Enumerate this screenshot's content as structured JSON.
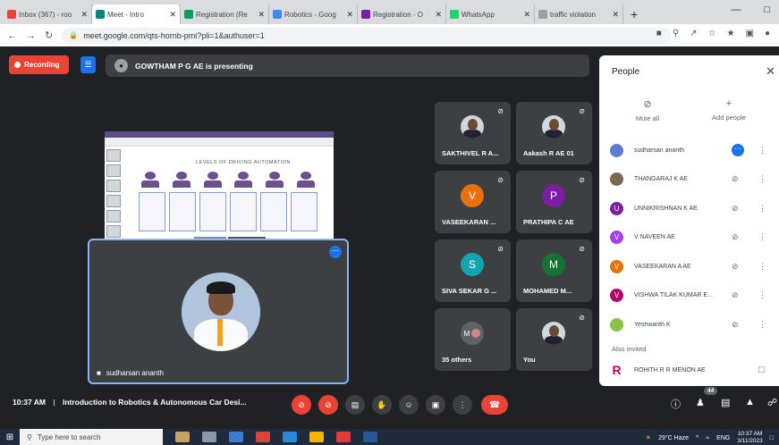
{
  "browser": {
    "tabs": [
      {
        "label": "Inbox (367) - roo",
        "color": "#ea4335",
        "active": false
      },
      {
        "label": "Meet - Intro",
        "color": "#00897b",
        "active": true
      },
      {
        "label": "Registration (Re",
        "color": "#0f9d58",
        "active": false
      },
      {
        "label": "Robotics - Goog",
        "color": "#4285f4",
        "active": false
      },
      {
        "label": "Registration - O",
        "color": "#7b1fa2",
        "active": false
      },
      {
        "label": "WhatsApp",
        "color": "#25d366",
        "active": false
      },
      {
        "label": "traffic violation",
        "color": "#9e9e9e",
        "active": false
      }
    ],
    "new_tab": "+",
    "url": "meet.google.com/qts-hornb-pmi?pli=1&authuser=1"
  },
  "meet": {
    "recording_label": "Recording",
    "presenter_text": "GOWTHAM P G AE is presenting",
    "slide": {
      "title": "LEVELS OF DRIVING AUTOMATION"
    },
    "self_tile_name": "sudharsan ananth",
    "tiles": [
      {
        "name": "SAKTHIVEL R A...",
        "avatar_type": "photo"
      },
      {
        "name": "Aakash R AE 01",
        "avatar_type": "photo"
      },
      {
        "name": "VASEEKARAN ...",
        "avatar_type": "letter",
        "letter": "V",
        "color": "#e8710a"
      },
      {
        "name": "PRATHIPA C AE",
        "avatar_type": "letter",
        "letter": "P",
        "color": "#7b1fa2"
      },
      {
        "name": "SIVA SEKAR G ...",
        "avatar_type": "letter",
        "letter": "S",
        "color": "#12a4af"
      },
      {
        "name": "MOHAMED M...",
        "avatar_type": "letter",
        "letter": "M",
        "color": "#137333"
      },
      {
        "name": "35 others",
        "avatar_type": "group",
        "letter": "M"
      },
      {
        "name": "You",
        "avatar_type": "photo"
      }
    ],
    "people_panel": {
      "title": "People",
      "mute_all": "Mute all",
      "add_people": "Add people",
      "participants": [
        {
          "name": "sudharsan ananth",
          "letter": "",
          "color": "#5b7bd5"
        },
        {
          "name": "THANGARAJ K AE",
          "letter": "",
          "color": "#7a6a55"
        },
        {
          "name": "UNNIKRISHNAN K AE",
          "letter": "U",
          "color": "#7b1fa2"
        },
        {
          "name": "V NAVEEN AE",
          "letter": "V",
          "color": "#a142f4"
        },
        {
          "name": "VASEEKARAN A AE",
          "letter": "V",
          "color": "#e8710a"
        },
        {
          "name": "VISHWA TILAK KUMAR E...",
          "letter": "V",
          "color": "#b5006b"
        },
        {
          "name": "Yeshwanth K",
          "letter": "",
          "color": "#8bc34a"
        }
      ],
      "also_invited": "Also invited",
      "invited": {
        "name": "ROHITH R R MENON AE",
        "letter": "R",
        "color": "#b5006b"
      }
    },
    "bottom_bar": {
      "time": "10:37 AM",
      "separator": "|",
      "meeting_title": "Introduction to Robotics & Autonomous Car Desi...",
      "people_count": "44"
    }
  },
  "taskbar": {
    "search_placeholder": "Type here to search",
    "weather": "29°C  Haze",
    "language": "ENG",
    "clock_time": "10:37 AM",
    "clock_date": "3/11/2023"
  }
}
